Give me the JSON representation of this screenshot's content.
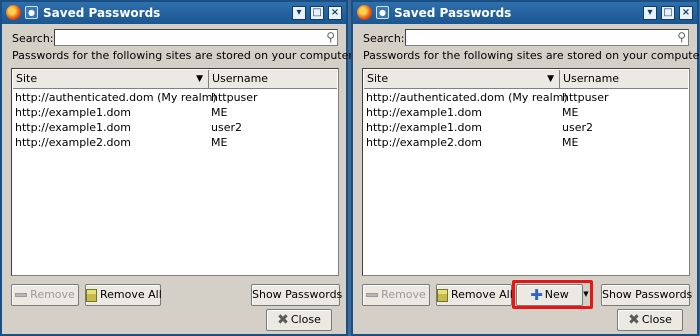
{
  "window": {
    "title": "Saved Passwords",
    "search_label": "Search:",
    "search_value": "",
    "description": "Passwords for the following sites are stored on your computer:",
    "columns": {
      "site": "Site",
      "username": "Username"
    },
    "rows": [
      {
        "site": "http://authenticated.dom (My realm)",
        "username": "httpuser"
      },
      {
        "site": "http://example1.dom",
        "username": "ME"
      },
      {
        "site": "http://example1.dom",
        "username": "user2"
      },
      {
        "site": "http://example2.dom",
        "username": "ME"
      }
    ],
    "buttons": {
      "remove": "Remove",
      "remove_all": "Remove All",
      "new": "New",
      "show_passwords": "Show Passwords",
      "close": "Close"
    }
  },
  "icons": {
    "app": "firefox-icon",
    "menu": "window-menu-icon",
    "search": "magnifier-icon",
    "sort": "sort-descending-icon",
    "remove": "minus-icon",
    "remove_all": "trash-icon",
    "new": "plus-icon",
    "close": "x-icon"
  },
  "colors": {
    "titlebar": "#1c5690",
    "highlight": "#ea1414",
    "plus_icon": "#2d66c2"
  }
}
